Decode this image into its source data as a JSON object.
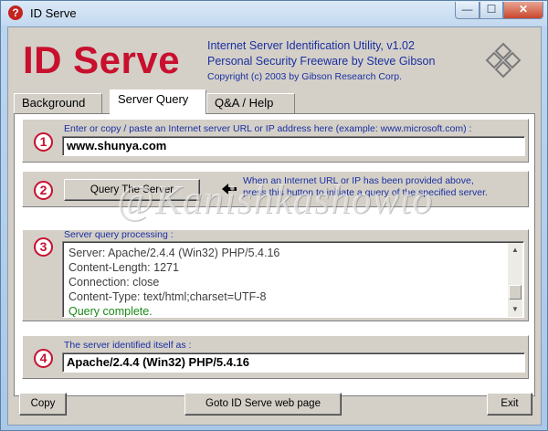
{
  "window": {
    "title": "ID Serve",
    "app_icon_glyph": "?",
    "min_glyph": "—",
    "max_glyph": "☐",
    "close_glyph": "✕"
  },
  "header": {
    "logo": "ID Serve",
    "line1": "Internet Server Identification Utility, v1.02",
    "line2": "Personal Security Freeware by Steve Gibson",
    "line3": "Copyright (c) 2003 by Gibson Research Corp."
  },
  "tabs": [
    {
      "label": "Background",
      "active": false
    },
    {
      "label": "Server Query",
      "active": true
    },
    {
      "label": "Q&A / Help",
      "active": false
    }
  ],
  "step1": {
    "number": "1",
    "label": "Enter or copy / paste an Internet server URL or IP address here (example: www.microsoft.com) :",
    "value": "www.shunya.com"
  },
  "step2": {
    "number": "2",
    "button": "Query The Server",
    "hint_line1": "When an Internet URL or IP has been provided above,",
    "hint_line2": "press this button to initiate a query of the specified server."
  },
  "step3": {
    "number": "3",
    "label": "Server query processing :",
    "lines": [
      "Server: Apache/2.4.4 (Win32) PHP/5.4.16",
      "Content-Length: 1271",
      "Connection: close",
      "Content-Type: text/html;charset=UTF-8"
    ],
    "status": "Query complete.",
    "scroll_up": "▲",
    "scroll_down": "▼"
  },
  "step4": {
    "number": "4",
    "label": "The server identified itself as :",
    "value": "Apache/2.4.4 (Win32) PHP/5.4.16"
  },
  "buttons": {
    "copy": "Copy",
    "goto": "Goto ID Serve web page",
    "exit": "Exit"
  },
  "watermark": "@Kanishkashowto",
  "colors": {
    "logo_red": "#c8102e",
    "label_blue": "#1a2fa0",
    "status_green": "#1a8a1a"
  }
}
